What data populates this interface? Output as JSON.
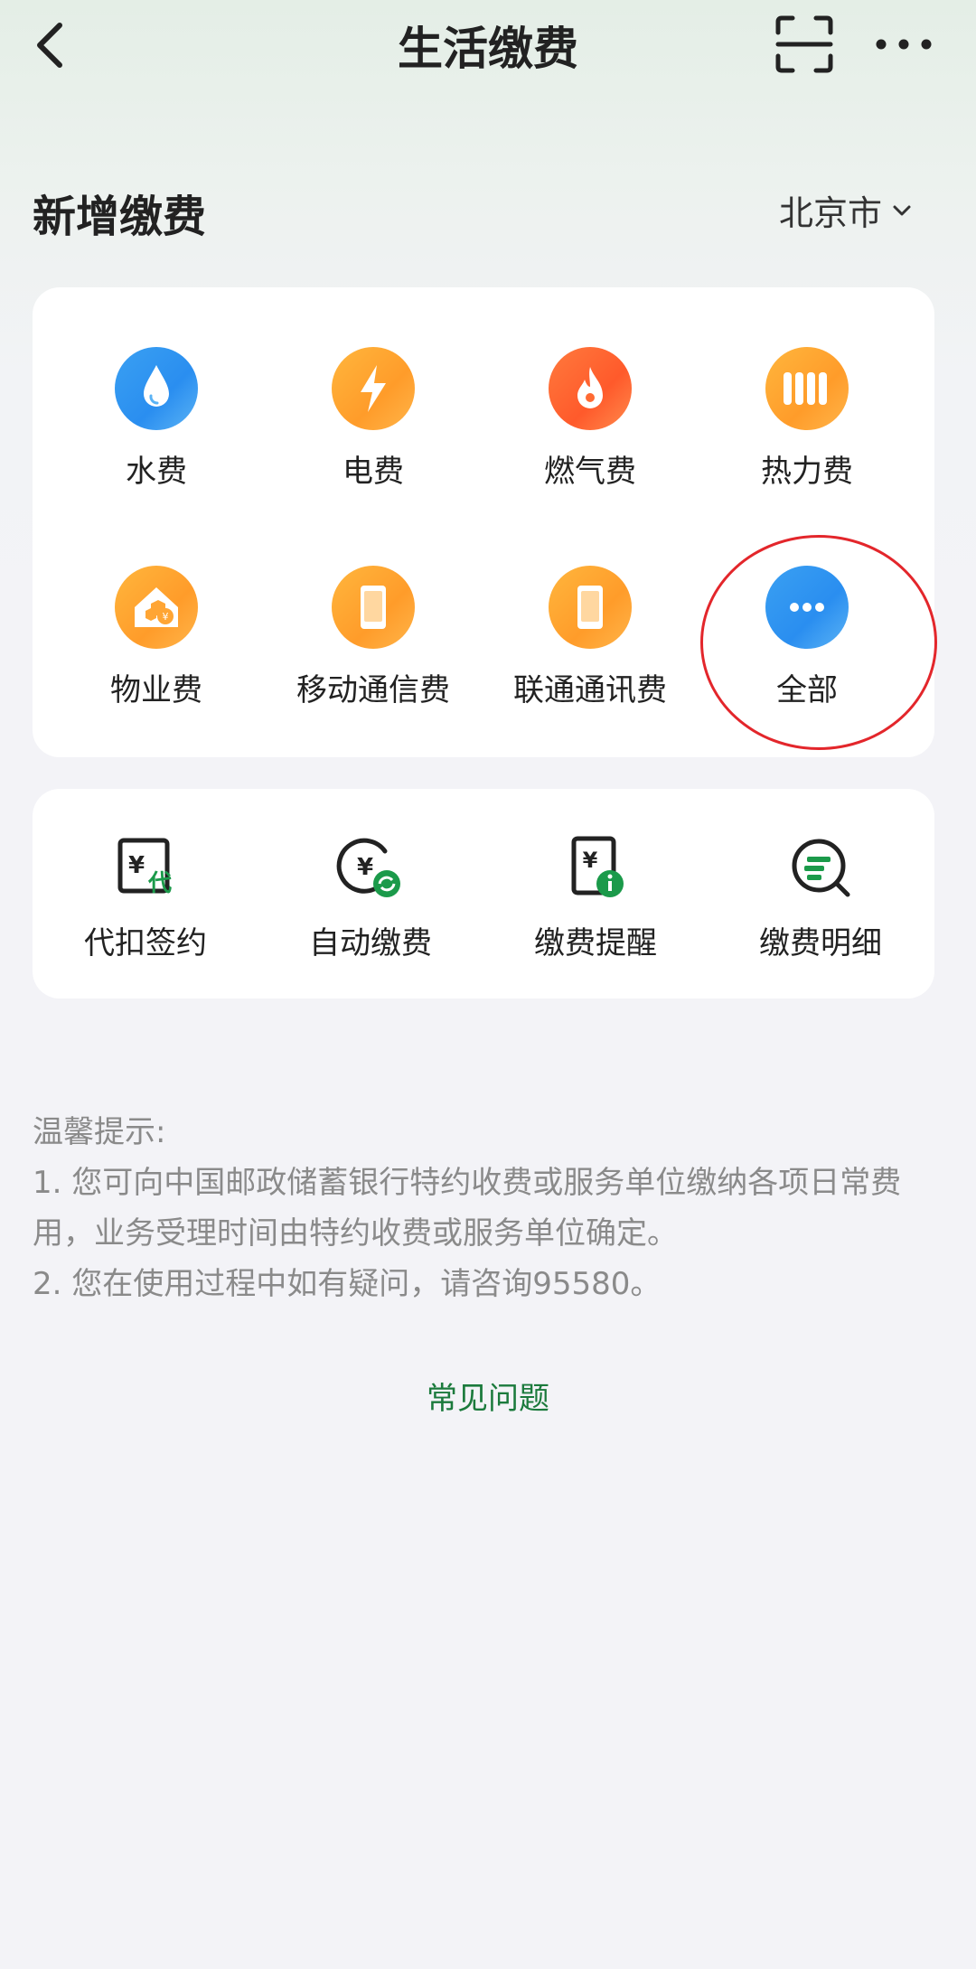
{
  "header": {
    "title": "生活缴费"
  },
  "section": {
    "title": "新增缴费",
    "city": "北京市"
  },
  "services": [
    {
      "label": "水费",
      "icon": "water-drop-icon"
    },
    {
      "label": "电费",
      "icon": "lightning-icon"
    },
    {
      "label": "燃气费",
      "icon": "flame-icon"
    },
    {
      "label": "热力费",
      "icon": "radiator-icon"
    },
    {
      "label": "物业费",
      "icon": "property-house-icon"
    },
    {
      "label": "移动通信费",
      "icon": "phone-icon"
    },
    {
      "label": "联通通讯费",
      "icon": "phone-icon"
    },
    {
      "label": "全部",
      "icon": "more-dots-icon"
    }
  ],
  "tools": [
    {
      "label": "代扣签约",
      "icon": "withhold-contract-icon"
    },
    {
      "label": "自动缴费",
      "icon": "auto-pay-icon"
    },
    {
      "label": "缴费提醒",
      "icon": "pay-reminder-icon"
    },
    {
      "label": "缴费明细",
      "icon": "pay-details-icon"
    }
  ],
  "tips": {
    "heading": "温馨提示:",
    "line1": "1.  您可向中国邮政储蓄银行特约收费或服务单位缴纳各项日常费用，业务受理时间由特约收费或服务单位确定。",
    "line2": "2.  您在使用过程中如有疑问，请咨询95580。"
  },
  "faq": {
    "label": "常见问题"
  },
  "colors": {
    "accent_green": "#1b7a3c",
    "annotation_red": "#e3262b"
  }
}
